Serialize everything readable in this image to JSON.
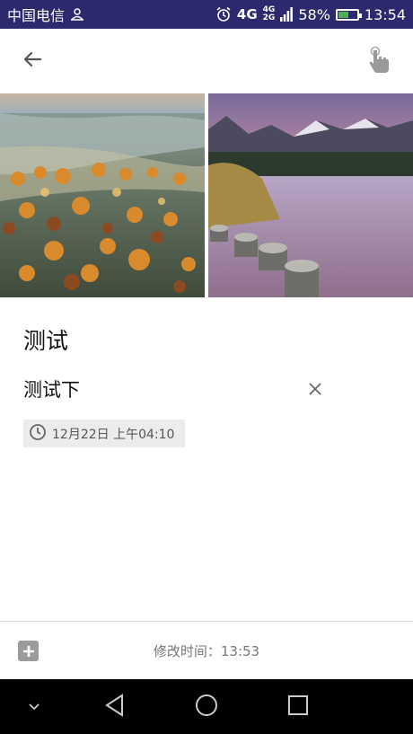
{
  "status_bar": {
    "carrier": "中国电信",
    "network": "4G",
    "network_small_top": "4G",
    "network_small_bottom": "2G",
    "battery": "58%",
    "battery_level": 0.58,
    "time": "13:54"
  },
  "toolbar": {
    "back_icon": "arrow-left-icon",
    "touch_icon": "hand-pointer-icon"
  },
  "note": {
    "title": "测试",
    "items": [
      {
        "text": "测试下"
      }
    ],
    "reminder": "12月22日 上午04:10"
  },
  "bottom_bar": {
    "modified_label": "修改时间：13:53"
  },
  "colors": {
    "status_bar_bg": "#2b2a6e",
    "reminder_bg": "#ececec",
    "nav_bar_bg": "#000000"
  }
}
